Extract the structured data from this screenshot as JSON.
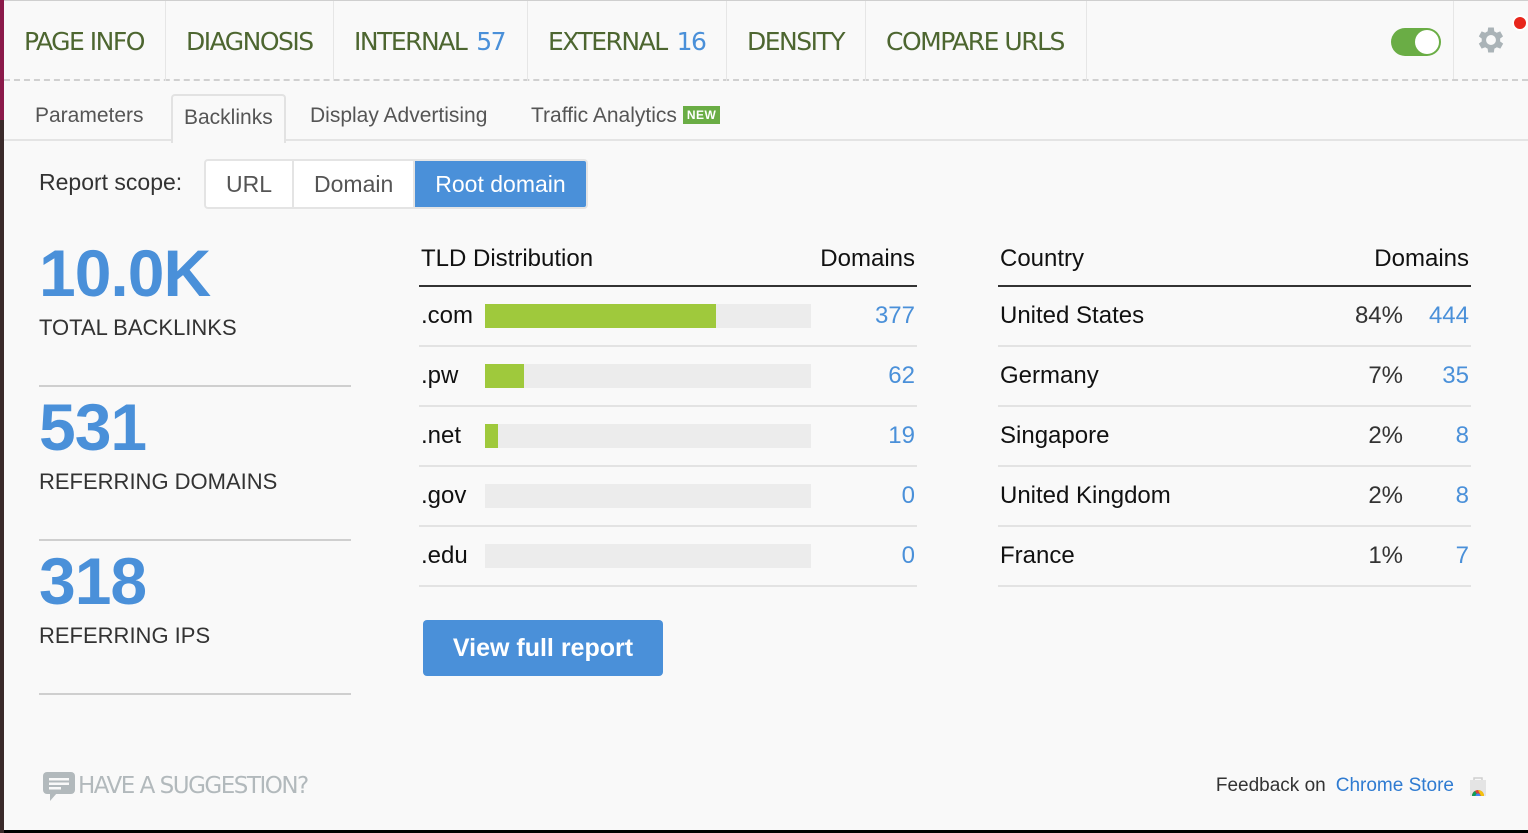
{
  "top_nav": {
    "tabs": [
      {
        "label": "PAGE INFO"
      },
      {
        "label": "DIAGNOSIS"
      },
      {
        "label": "INTERNAL",
        "count": "57"
      },
      {
        "label": "EXTERNAL",
        "count": "16"
      },
      {
        "label": "DENSITY"
      },
      {
        "label": "COMPARE URLS"
      }
    ],
    "toggle_on": true,
    "settings_notification": true
  },
  "sub_tabs": {
    "items": [
      {
        "label": "Parameters"
      },
      {
        "label": "Backlinks",
        "active": true
      },
      {
        "label": "Display Advertising"
      },
      {
        "label": "Traffic Analytics",
        "badge": "NEW"
      }
    ]
  },
  "report_scope": {
    "label": "Report scope:",
    "options": [
      "URL",
      "Domain",
      "Root domain"
    ],
    "selected": "Root domain"
  },
  "stats": [
    {
      "value": "10.0K",
      "label": "TOTAL BACKLINKS"
    },
    {
      "value": "531",
      "label": "REFERRING DOMAINS"
    },
    {
      "value": "318",
      "label": "REFERRING IPS"
    }
  ],
  "tld_table": {
    "header": "TLD Distribution",
    "value_header": "Domains",
    "rows": [
      {
        "tld": ".com",
        "domains": "377",
        "share": 0.71
      },
      {
        "tld": ".pw",
        "domains": "62",
        "share": 0.12
      },
      {
        "tld": ".net",
        "domains": "19",
        "share": 0.04
      },
      {
        "tld": ".gov",
        "domains": "0",
        "share": 0
      },
      {
        "tld": ".edu",
        "domains": "0",
        "share": 0
      }
    ],
    "button": "View full report"
  },
  "country_table": {
    "header": "Country",
    "value_header": "Domains",
    "rows": [
      {
        "country": "United States",
        "percent": "84%",
        "domains": "444"
      },
      {
        "country": "Germany",
        "percent": "7%",
        "domains": "35"
      },
      {
        "country": "Singapore",
        "percent": "2%",
        "domains": "8"
      },
      {
        "country": "United Kingdom",
        "percent": "2%",
        "domains": "8"
      },
      {
        "country": "France",
        "percent": "1%",
        "domains": "7"
      }
    ]
  },
  "footer": {
    "suggestion": "HAVE A SUGGESTION?",
    "feedback_prefix": "Feedback on",
    "feedback_link": "Chrome Store"
  },
  "colors": {
    "accent_blue": "#4a90d9",
    "nav_green": "#4d6630",
    "bar_green": "#9fc93c",
    "toggle_green": "#6aad45",
    "notification_red": "#e8261c"
  }
}
